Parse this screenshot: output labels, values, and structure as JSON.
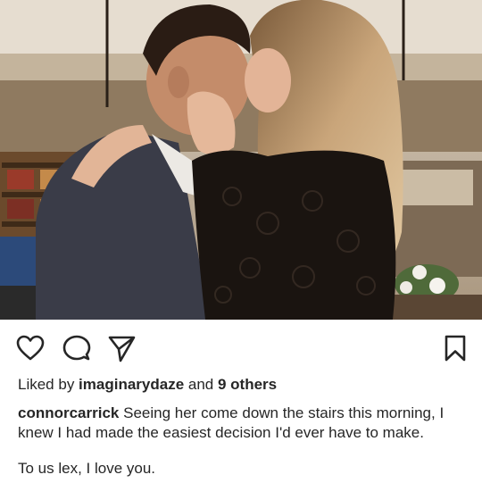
{
  "post": {
    "photo_icon": "couple-kissing-photo",
    "actions": {
      "like_icon": "heart-icon",
      "comment_icon": "comment-bubble-icon",
      "share_icon": "send-paper-plane-icon",
      "save_icon": "bookmark-icon"
    },
    "likes": {
      "prefix": "Liked by ",
      "user": "imaginarydaze",
      "middle": " and ",
      "others": "9 others"
    },
    "caption": {
      "username": "connorcarrick",
      "text": " Seeing her come down the stairs this morning, I knew I had made the easiest decision I'd ever have to make.",
      "line2": "To us lex, I love you."
    }
  },
  "colors": {
    "text": "#262626",
    "icon": "#262626",
    "background": "#ffffff"
  }
}
